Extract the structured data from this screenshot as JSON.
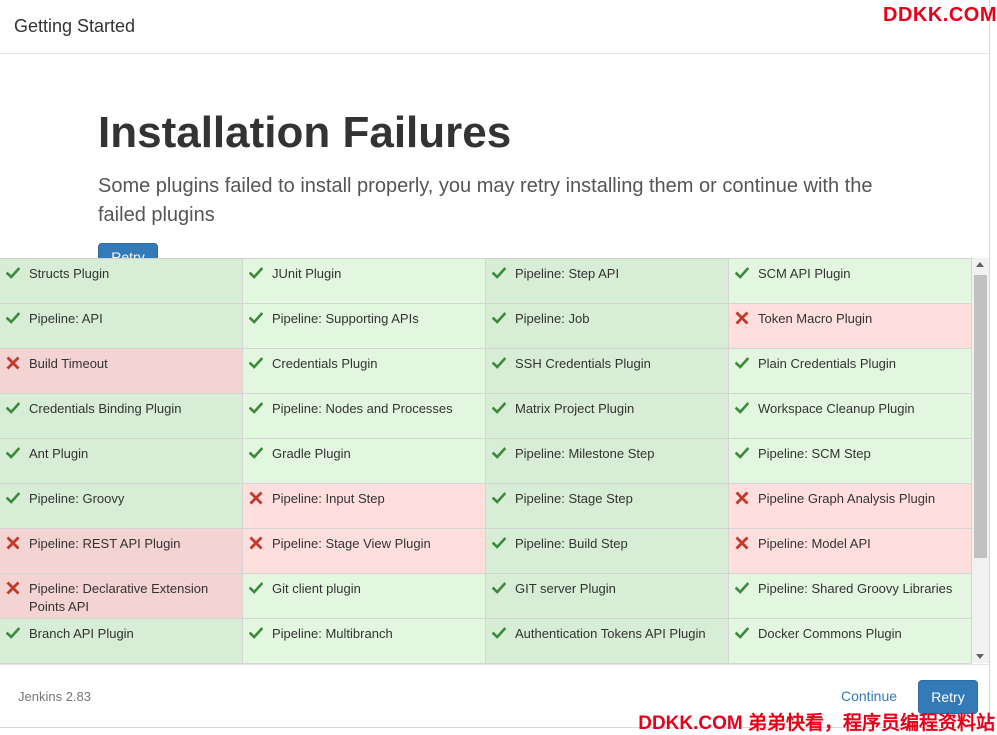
{
  "header": {
    "title": "Getting Started"
  },
  "watermark": {
    "top": "DDKK.COM",
    "bottom": "DDKK.COM 弟弟快看，程序员编程资料站"
  },
  "hero": {
    "title": "Installation Failures",
    "subtitle": "Some plugins failed to install properly, you may retry installing them or continue with the failed plugins",
    "retry_label": "Retry"
  },
  "colors": {
    "ok_icon": "#3c8a3c",
    "fail_icon": "#c0392b",
    "primary": "#337ab7"
  },
  "plugins": [
    {
      "name": "Structs Plugin",
      "status": "ok"
    },
    {
      "name": "JUnit Plugin",
      "status": "ok"
    },
    {
      "name": "Pipeline: Step API",
      "status": "ok"
    },
    {
      "name": "SCM API Plugin",
      "status": "ok"
    },
    {
      "name": "Pipeline: API",
      "status": "ok"
    },
    {
      "name": "Pipeline: Supporting APIs",
      "status": "ok"
    },
    {
      "name": "Pipeline: Job",
      "status": "ok"
    },
    {
      "name": "Token Macro Plugin",
      "status": "fail"
    },
    {
      "name": "Build Timeout",
      "status": "fail"
    },
    {
      "name": "Credentials Plugin",
      "status": "ok"
    },
    {
      "name": "SSH Credentials Plugin",
      "status": "ok"
    },
    {
      "name": "Plain Credentials Plugin",
      "status": "ok"
    },
    {
      "name": "Credentials Binding Plugin",
      "status": "ok"
    },
    {
      "name": "Pipeline: Nodes and Processes",
      "status": "ok"
    },
    {
      "name": "Matrix Project Plugin",
      "status": "ok"
    },
    {
      "name": "Workspace Cleanup Plugin",
      "status": "ok"
    },
    {
      "name": "Ant Plugin",
      "status": "ok"
    },
    {
      "name": "Gradle Plugin",
      "status": "ok"
    },
    {
      "name": "Pipeline: Milestone Step",
      "status": "ok"
    },
    {
      "name": "Pipeline: SCM Step",
      "status": "ok"
    },
    {
      "name": "Pipeline: Groovy",
      "status": "ok"
    },
    {
      "name": "Pipeline: Input Step",
      "status": "fail"
    },
    {
      "name": "Pipeline: Stage Step",
      "status": "ok"
    },
    {
      "name": "Pipeline Graph Analysis Plugin",
      "status": "fail"
    },
    {
      "name": "Pipeline: REST API Plugin",
      "status": "fail"
    },
    {
      "name": "Pipeline: Stage View Plugin",
      "status": "fail"
    },
    {
      "name": "Pipeline: Build Step",
      "status": "ok"
    },
    {
      "name": "Pipeline: Model API",
      "status": "fail"
    },
    {
      "name": "Pipeline: Declarative Extension Points API",
      "status": "fail"
    },
    {
      "name": "Git client plugin",
      "status": "ok"
    },
    {
      "name": "GIT server Plugin",
      "status": "ok"
    },
    {
      "name": "Pipeline: Shared Groovy Libraries",
      "status": "ok"
    },
    {
      "name": "Branch API Plugin",
      "status": "ok"
    },
    {
      "name": "Pipeline: Multibranch",
      "status": "ok"
    },
    {
      "name": "Authentication Tokens API Plugin",
      "status": "ok"
    },
    {
      "name": "Docker Commons Plugin",
      "status": "ok"
    }
  ],
  "footer": {
    "version": "Jenkins 2.83",
    "continue_label": "Continue",
    "retry_label": "Retry"
  }
}
